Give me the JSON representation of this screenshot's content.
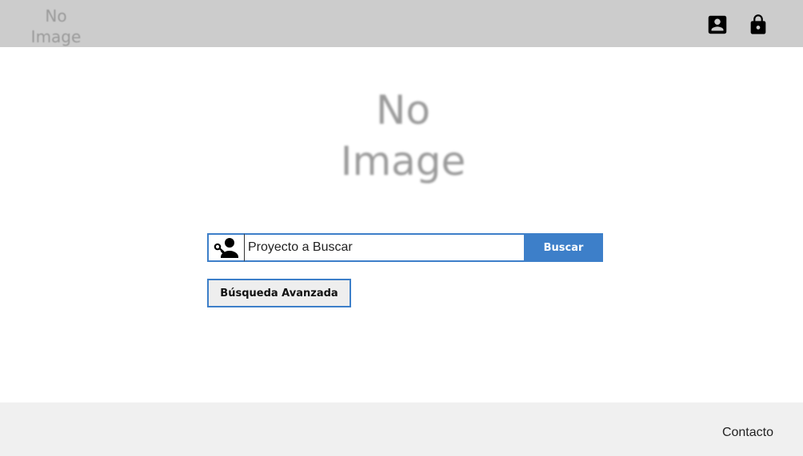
{
  "header": {
    "logo_line1": "No",
    "logo_line2": "Image",
    "icons": [
      "account-box-icon",
      "lock-icon"
    ]
  },
  "hero": {
    "logo_line1": "No",
    "logo_line2": "Image"
  },
  "search": {
    "addon_icon": "person-key-icon",
    "placeholder": "Proyecto a Buscar",
    "value": "",
    "button_label": "Buscar",
    "advanced_label": "Búsqueda Avanzada"
  },
  "footer": {
    "contact_label": "Contacto"
  },
  "colors": {
    "topbar": "#cccccc",
    "accent": "#3d7fc9",
    "footer": "#f0f0f0"
  }
}
